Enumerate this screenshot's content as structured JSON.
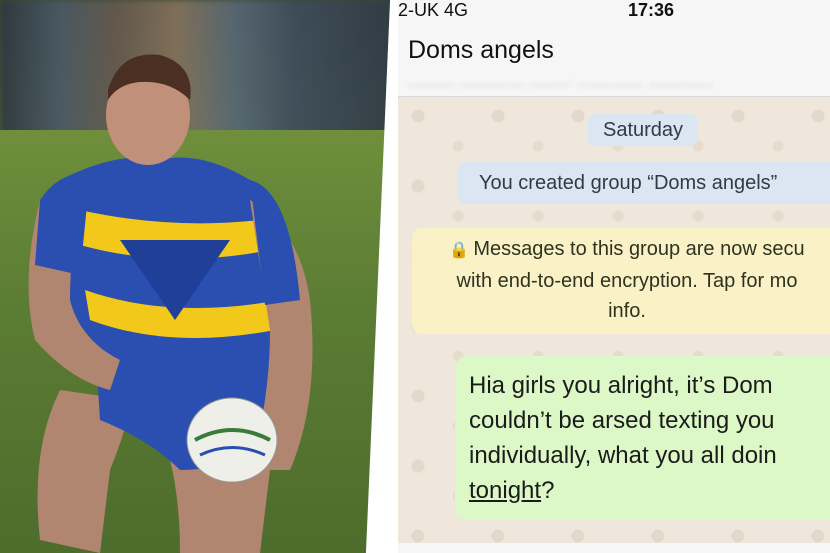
{
  "status_bar": {
    "carrier": "2-UK  4G",
    "time": "17:36"
  },
  "chat_header": {
    "title": "Doms angels",
    "members": "_____ _______ ____, _______ _______"
  },
  "messages": {
    "date_pill": "Saturday",
    "system_created": "You created group “Doms angels”",
    "encryption_lines": [
      "Messages to this group are now secu",
      "with end-to-end encryption. Tap for mo",
      "info."
    ],
    "outgoing_lines": [
      "Hia girls you alright, it’s Dom",
      "couldn’t be arsed texting you",
      "individually, what you all doin",
      "tonight",
      "?"
    ]
  },
  "icons": {
    "lock": "lock-icon"
  },
  "colors": {
    "chat_background": "#efe7dc",
    "system_bubble": "#dbe6f3",
    "encryption_bubble": "#fbf1c7",
    "outgoing_bubble": "#dcf8c6",
    "jersey_blue": "#2a4fb0",
    "jersey_yellow": "#f2c81a"
  }
}
